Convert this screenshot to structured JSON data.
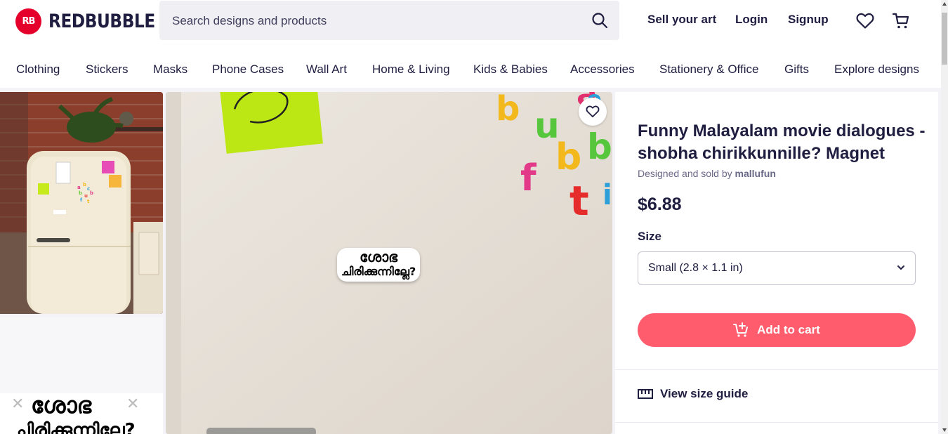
{
  "header": {
    "logo_text": "REDBUBBLE",
    "logo_initials": "RB",
    "search_placeholder": "Search designs and products",
    "sell_link": "Sell your art",
    "login_link": "Login",
    "signup_link": "Signup"
  },
  "nav": {
    "items": [
      "Clothing",
      "Stickers",
      "Masks",
      "Phone Cases",
      "Wall Art",
      "Home & Living",
      "Kids & Babies",
      "Accessories",
      "Stationery & Office",
      "Gifts",
      "Explore designs"
    ]
  },
  "gallery": {
    "sticker_line1": "ശോഭ",
    "sticker_line2": "ചിരിക്കുന്നില്ലേ?"
  },
  "product": {
    "title": "Funny Malayalam movie dialogues - shobha chirikkunnille? Magnet",
    "designer_prefix": "Designed and sold by",
    "designer_name": "mallufun",
    "price": "$6.88",
    "size_label": "Size",
    "size_value": "Small (2.8 × 1.1 in)",
    "cart_label": "Add to cart",
    "size_guide_label": "View size guide"
  },
  "colors": {
    "brand": "#e4002b",
    "cart_button": "#ff5c6e",
    "text": "#1f1d40"
  }
}
